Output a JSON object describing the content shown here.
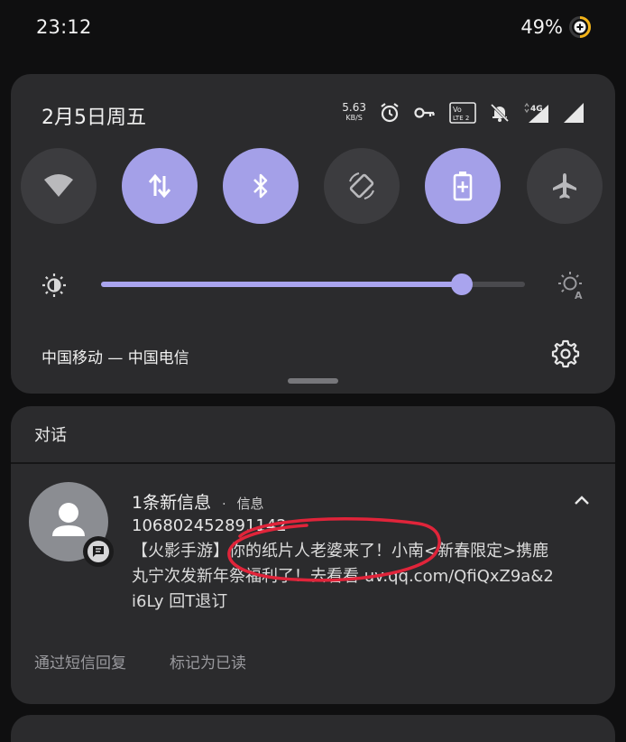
{
  "status_bar": {
    "time": "23:12",
    "battery_percent": "49%"
  },
  "quick_settings": {
    "date": "2月5日周五",
    "net_speed_value": "5.63",
    "net_speed_unit": "KB/S",
    "network_type": "4G",
    "status_icons": [
      "alarm-icon",
      "key-icon",
      "volte-icon",
      "bell-off-icon",
      "signal-4g-icon",
      "signal-icon"
    ],
    "tiles": [
      {
        "name": "wifi",
        "state": "off"
      },
      {
        "name": "mobile-data",
        "state": "on"
      },
      {
        "name": "bluetooth",
        "state": "on"
      },
      {
        "name": "auto-rotate",
        "state": "off"
      },
      {
        "name": "battery-saver",
        "state": "on"
      },
      {
        "name": "airplane-mode",
        "state": "off"
      }
    ],
    "brightness_level": 0.85,
    "carrier": "中国移动 — 中国电信",
    "accent_color": "#a4a0e8"
  },
  "conversation": {
    "header": "对话",
    "notification": {
      "title": "1条新信息",
      "separator": "·",
      "app_name": "信息",
      "sender": "10680245289114​2",
      "body": "【火影手游】你的纸片人老婆来了！小南<新春限定>携鹿丸宁次发新年祭福利了！去看看 uv.qq.com/QfiQxZ9a&2i6Ly 回T退订"
    },
    "actions": {
      "reply": "通过短信回复",
      "mark_read": "标记为已读"
    }
  }
}
